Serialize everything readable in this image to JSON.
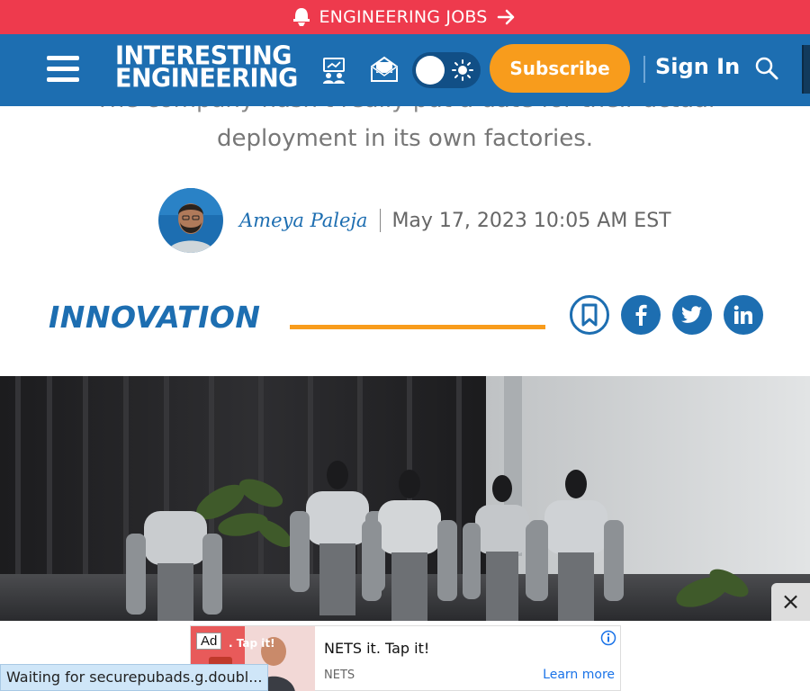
{
  "jobs_banner": {
    "label": "ENGINEERING JOBS",
    "icon": "hard-hat-icon",
    "arrow_icon": "arrow-right-icon",
    "color": "#ee3a4d"
  },
  "header": {
    "brand_color": "#1d6eb1",
    "logo_line1": "INTERESTING",
    "logo_line2": "ENGINEERING",
    "subscribe_label": "Subscribe",
    "subscribe_color": "#f89c1c",
    "signin_label": "Sign In",
    "icons": [
      "menu-icon",
      "webinar-icon",
      "newsletter-icon",
      "theme-toggle-icon",
      "search-icon"
    ]
  },
  "article": {
    "subtitle_cut": "The company hasn't really put a date for their actual",
    "subtitle_line2": "deployment in its own factories.",
    "author": "Ameya Paleja",
    "date": "May 17, 2023 10:05 AM EST",
    "category": "INNOVATION",
    "share_icons": [
      "bookmark-icon",
      "facebook-icon",
      "twitter-icon",
      "linkedin-icon"
    ]
  },
  "ad": {
    "tag": "Ad",
    "image_text": ". Tap it!",
    "headline": "NETS it. Tap it!",
    "brand": "NETS",
    "cta": "Learn more"
  },
  "status": {
    "text": "Waiting for securepubads.g.doubl..."
  },
  "close_label": "×"
}
